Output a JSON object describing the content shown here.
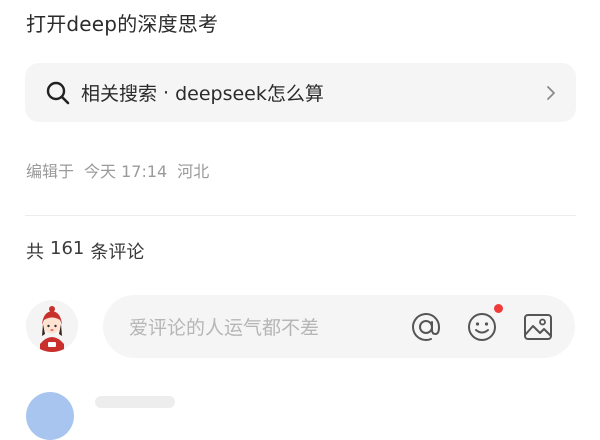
{
  "post": {
    "text": "打开deep的深度思考"
  },
  "related_search": {
    "prefix": "相关搜索",
    "separator": "·",
    "query": "deepseek怎么算",
    "icon": "search-icon",
    "chevron": "chevron-right-icon"
  },
  "meta": {
    "edited_label": "编辑于",
    "date": "今天 17:14",
    "location": "河北"
  },
  "comments": {
    "prefix": "共",
    "count": "161",
    "suffix": "条评论"
  },
  "comment_input": {
    "placeholder": "爱评论的人运气都不差",
    "icons": [
      "at-icon",
      "emoji-icon",
      "image-icon"
    ],
    "emoji_has_badge": true
  },
  "colors": {
    "badge": "#f03b3b",
    "panel": "#f5f5f5",
    "muted_text": "#9a9a9a",
    "placeholder": "#b6b6b6"
  }
}
